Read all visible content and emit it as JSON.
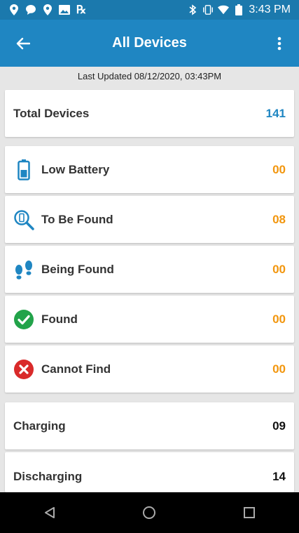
{
  "status_bar": {
    "time": "3:43 PM",
    "left_icons": [
      "location-icon",
      "chat-icon",
      "location-icon",
      "image-icon",
      "rx-icon"
    ],
    "right_icons": [
      "bluetooth-icon",
      "vibrate-icon",
      "wifi-icon",
      "battery-icon"
    ],
    "rx_label": "℞"
  },
  "app_bar": {
    "title": "All Devices",
    "back_icon": "arrow-left-icon",
    "menu_icon": "more-vert-icon"
  },
  "last_updated": "Last Updated 08/12/2020, 03:43PM",
  "total": {
    "label": "Total Devices",
    "value": "141"
  },
  "status_items": [
    {
      "label": "Low Battery",
      "value": "00",
      "icon": "battery-icon"
    },
    {
      "label": "To Be Found",
      "value": "08",
      "icon": "search-device-icon"
    },
    {
      "label": "Being Found",
      "value": "00",
      "icon": "footsteps-icon"
    },
    {
      "label": "Found",
      "value": "00",
      "icon": "check-circle-icon"
    },
    {
      "label": "Cannot Find",
      "value": "00",
      "icon": "cancel-circle-icon"
    }
  ],
  "charge_items": [
    {
      "label": "Charging",
      "value": "09"
    },
    {
      "label": "Discharging",
      "value": "14"
    }
  ],
  "colors": {
    "app_bar": "#1f86c2",
    "status_bar": "#1b79ad",
    "total_value": "#1f86c2",
    "status_value": "#f2960d",
    "found_green": "#22a34a",
    "cannot_red": "#d92a2a"
  }
}
